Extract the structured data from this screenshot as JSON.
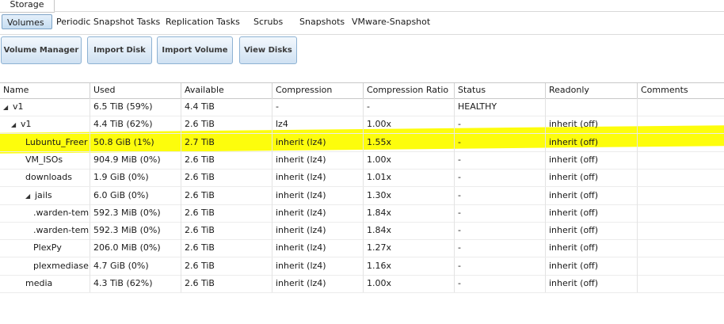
{
  "top_tab": "Storage",
  "subtabs": [
    {
      "label": "Volumes",
      "active": true
    },
    {
      "label": "Periodic Snapshot Tasks",
      "active": false
    },
    {
      "label": "Replication Tasks",
      "active": false
    },
    {
      "label": "Scrubs",
      "active": false
    },
    {
      "label": "Snapshots",
      "active": false
    },
    {
      "label": "VMware-Snapshot",
      "active": false
    }
  ],
  "buttons": [
    "Volume Manager",
    "Import Disk",
    "Import Volume",
    "View Disks"
  ],
  "columns": [
    "Name",
    "Used",
    "Available",
    "Compression",
    "Compression Ratio",
    "Status",
    "Readonly",
    "Comments"
  ],
  "rows": [
    {
      "name": "v1",
      "indent": 0,
      "expanded": true,
      "used": "6.5 TiB (59%)",
      "available": "4.4 TiB",
      "compression": "-",
      "ratio": "-",
      "status": "HEALTHY",
      "readonly": "",
      "comments": ""
    },
    {
      "name": "v1",
      "indent": 1,
      "expanded": true,
      "used": "4.4 TiB (62%)",
      "available": "2.6 TiB",
      "compression": "lz4",
      "ratio": "1.00x",
      "status": "-",
      "readonly": "inherit (off)",
      "comments": ""
    },
    {
      "name": "Lubuntu_Freer",
      "indent": 2,
      "expanded": null,
      "used": "50.8 GiB (1%)",
      "available": "2.7 TiB",
      "compression": "inherit (lz4)",
      "ratio": "1.55x",
      "status": "-",
      "readonly": "inherit (off)",
      "comments": ""
    },
    {
      "name": "VM_ISOs",
      "indent": 2,
      "expanded": null,
      "used": "904.9 MiB (0%)",
      "available": "2.6 TiB",
      "compression": "inherit (lz4)",
      "ratio": "1.00x",
      "status": "-",
      "readonly": "inherit (off)",
      "comments": ""
    },
    {
      "name": "downloads",
      "indent": 2,
      "expanded": null,
      "used": "1.9 GiB (0%)",
      "available": "2.6 TiB",
      "compression": "inherit (lz4)",
      "ratio": "1.01x",
      "status": "-",
      "readonly": "inherit (off)",
      "comments": ""
    },
    {
      "name": "jails",
      "indent": 2,
      "expanded": true,
      "used": "6.0 GiB (0%)",
      "available": "2.6 TiB",
      "compression": "inherit (lz4)",
      "ratio": "1.30x",
      "status": "-",
      "readonly": "inherit (off)",
      "comments": ""
    },
    {
      "name": ".warden-tem",
      "indent": 3,
      "expanded": null,
      "used": "592.3 MiB (0%)",
      "available": "2.6 TiB",
      "compression": "inherit (lz4)",
      "ratio": "1.84x",
      "status": "-",
      "readonly": "inherit (off)",
      "comments": ""
    },
    {
      "name": ".warden-tem",
      "indent": 3,
      "expanded": null,
      "used": "592.3 MiB (0%)",
      "available": "2.6 TiB",
      "compression": "inherit (lz4)",
      "ratio": "1.84x",
      "status": "-",
      "readonly": "inherit (off)",
      "comments": ""
    },
    {
      "name": "PlexPy",
      "indent": 3,
      "expanded": null,
      "used": "206.0 MiB (0%)",
      "available": "2.6 TiB",
      "compression": "inherit (lz4)",
      "ratio": "1.27x",
      "status": "-",
      "readonly": "inherit (off)",
      "comments": ""
    },
    {
      "name": "plexmediase",
      "indent": 3,
      "expanded": null,
      "used": "4.7 GiB (0%)",
      "available": "2.6 TiB",
      "compression": "inherit (lz4)",
      "ratio": "1.16x",
      "status": "-",
      "readonly": "inherit (off)",
      "comments": ""
    },
    {
      "name": "media",
      "indent": 2,
      "expanded": null,
      "used": "4.3 TiB (62%)",
      "available": "2.6 TiB",
      "compression": "inherit (lz4)",
      "ratio": "1.00x",
      "status": "-",
      "readonly": "inherit (off)",
      "comments": ""
    }
  ],
  "highlight_color": "#fdfd0c",
  "accent_color": "#8eb2d3"
}
